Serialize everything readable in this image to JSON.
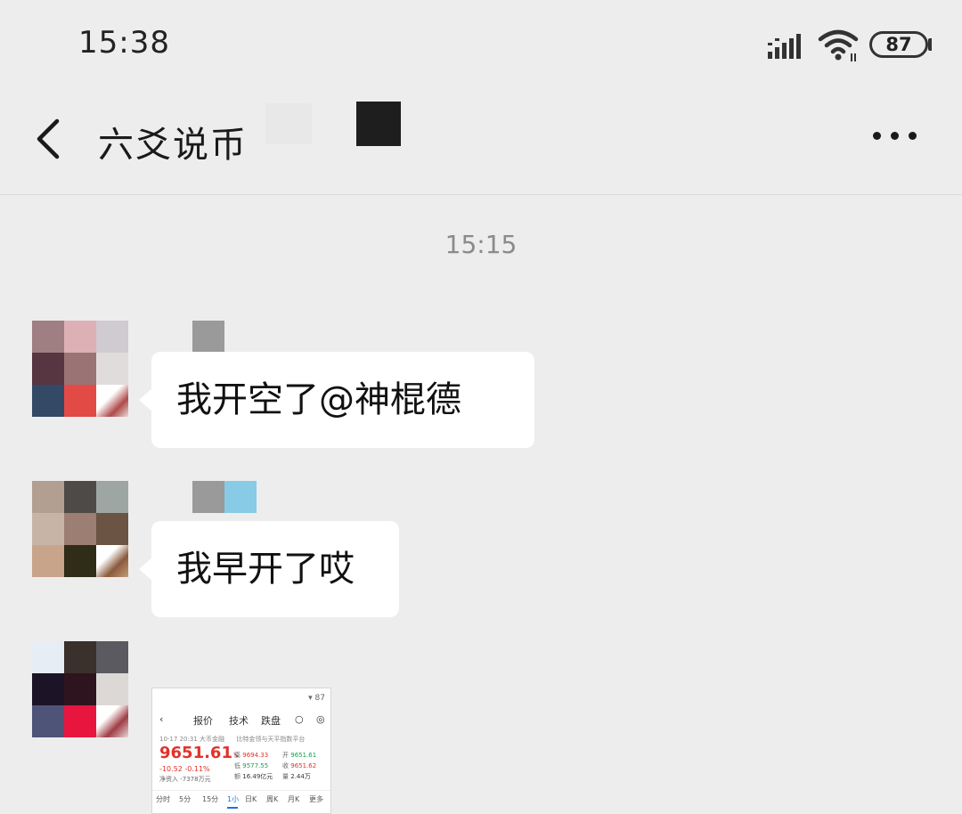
{
  "status_bar": {
    "time": "15:38",
    "battery": "87"
  },
  "header": {
    "title": "六爻说币"
  },
  "chat": {
    "timestamp": "15:15",
    "messages": [
      {
        "text": "我开空了@神棍德"
      },
      {
        "text": "我早开了哎"
      }
    ],
    "image_message": {
      "status": "▾ 87",
      "nav": [
        "报价",
        "技术",
        "跌盘"
      ],
      "info_left": "10-17 20:31  大币金融",
      "info_right": "比特金领与天平指数平台",
      "price": "9651.61",
      "price_suffix": "↘",
      "change": "-10.52   -0.11%",
      "sub": "净资入   -7378万元",
      "stats": [
        {
          "label": "高",
          "value": "9694.33"
        },
        {
          "label": "开",
          "value": "9651.61"
        },
        {
          "label": "低",
          "value": "9577.55"
        },
        {
          "label": "收",
          "value": "9651.62"
        },
        {
          "label": "额",
          "value": "16.49亿元"
        },
        {
          "label": "量",
          "value": "2.44万"
        }
      ],
      "tabs": [
        "分时",
        "5分",
        "15分",
        "1小",
        "日K",
        "周K",
        "月K",
        "更多"
      ]
    }
  },
  "colors": {
    "background": "#ededed",
    "bubble": "#ffffff",
    "price_red": "#e0332c",
    "price_green": "#12a150",
    "accent_blue": "#1a73e8"
  }
}
